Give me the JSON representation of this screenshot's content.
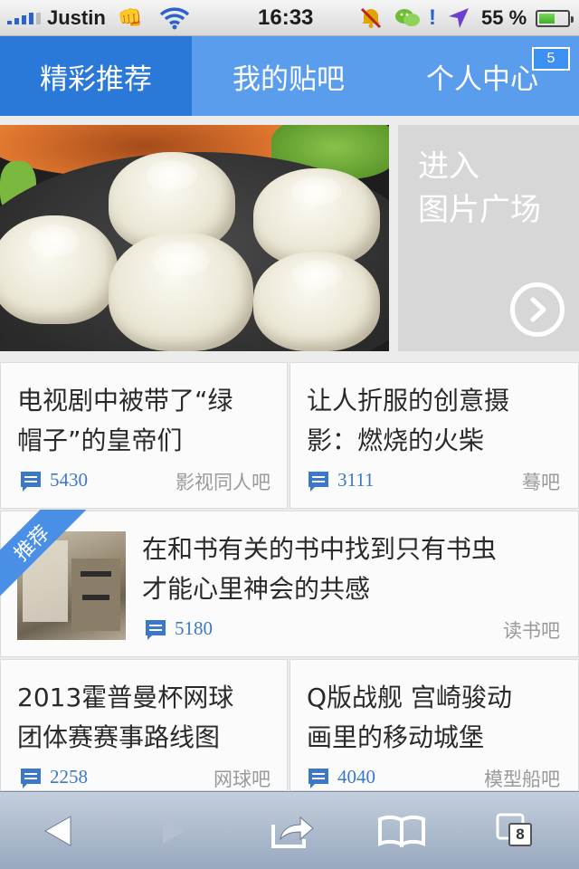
{
  "status_bar": {
    "carrier": "Justin",
    "carrier_emoji": "👊",
    "time": "16:33",
    "alert_mark": "!",
    "battery_text": "55 %",
    "battery_level": 0.55,
    "icons": [
      "signal-icon",
      "wifi-icon",
      "mute-icon",
      "wechat-icon",
      "location-icon",
      "battery-icon"
    ]
  },
  "tabs": [
    {
      "label": "精彩推荐",
      "active": true
    },
    {
      "label": "我的贴吧",
      "active": false
    },
    {
      "label": "个人中心",
      "active": false,
      "badge": "5"
    }
  ],
  "featured": {
    "gallery_line1": "进入",
    "gallery_line2": "图片广场"
  },
  "posts": [
    {
      "title_line1": "电视剧中被带了“绿",
      "title_line2": "帽子”的皇帝们",
      "count": "5430",
      "bar": "影视同人吧"
    },
    {
      "title_line1": "让人折服的创意摄",
      "title_line2": "影：燃烧的火柴",
      "count": "3111",
      "bar": "蓦吧"
    },
    {
      "title_line1": "在和书有关的书中找到只有书虫",
      "title_line2": "才能心里神会的共感",
      "count": "5180",
      "bar": "读书吧",
      "ribbon": "推荐"
    },
    {
      "title_line1": "2013霍普曼杯网球",
      "title_line2": "团体赛赛事路线图",
      "count": "2258",
      "bar": "网球吧"
    },
    {
      "title_line1": "Q版战舰 宫崎骏动",
      "title_line2": "画里的移动城堡",
      "count": "4040",
      "bar": "模型船吧"
    }
  ],
  "toolbar": {
    "tabs_count": "8",
    "icons": [
      "back-icon",
      "forward-icon",
      "share-icon",
      "bookmarks-icon",
      "tabs-icon"
    ]
  },
  "colors": {
    "tab_bar": "#5b9ded",
    "tab_active": "#2a78d7",
    "count_blue": "#3c78c8",
    "ribbon": "#4a8fe6"
  }
}
